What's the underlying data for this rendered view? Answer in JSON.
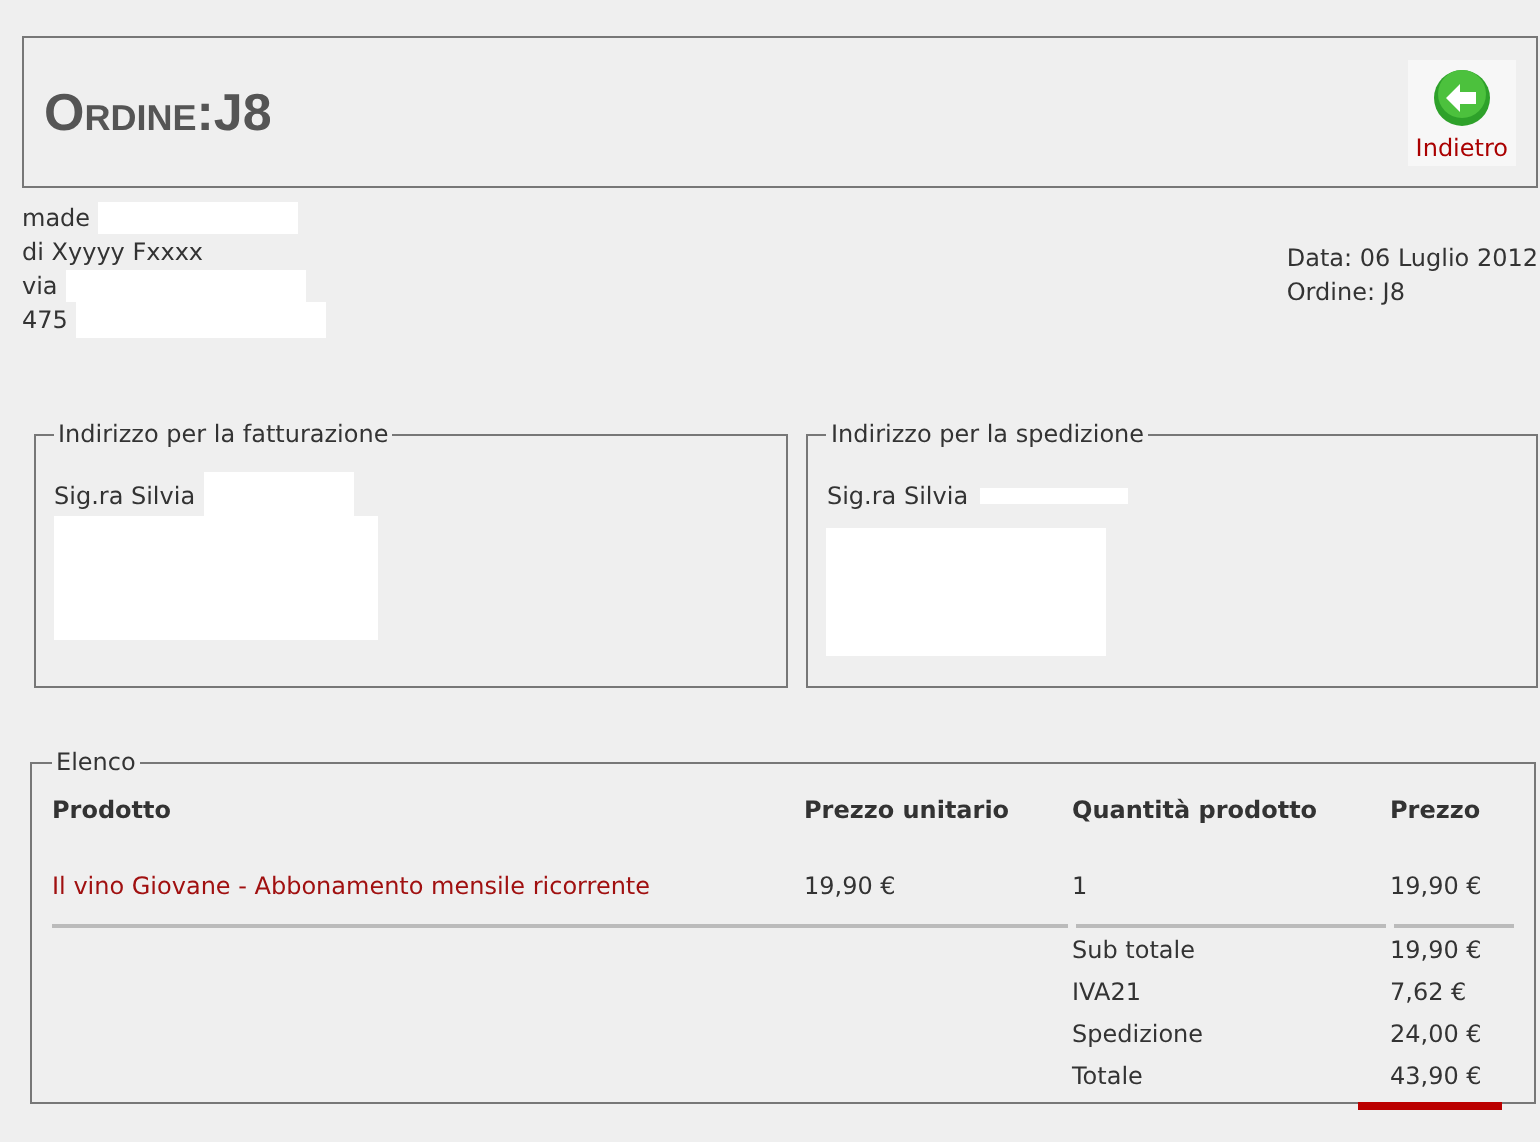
{
  "header": {
    "title": "Ordine:J8",
    "back_button": "Indietro"
  },
  "sender": {
    "lines": [
      "made",
      "di Xyyyy Fxxxx",
      "via",
      "475"
    ]
  },
  "order_info": {
    "date": "Data: 06 Luglio 2012",
    "order": "Ordine: J8"
  },
  "addresses": [
    {
      "legend": "Indirizzo per la fatturazione",
      "name": "Sig.ra Silvia"
    },
    {
      "legend": "Indirizzo per la spedizione",
      "name": "Sig.ra Silvia"
    }
  ],
  "items": {
    "legend": "Elenco",
    "columns": [
      "Prodotto",
      "Prezzo unitario",
      "Quantità prodotto",
      "Prezzo"
    ],
    "rows": [
      {
        "product": "Il vino Giovane - Abbonamento mensile ricorrente",
        "unit_price": "19,90 €",
        "quantity": "1",
        "price": "19,90 €"
      }
    ],
    "totals": [
      {
        "label": "Sub totale",
        "value": "19,90 €"
      },
      {
        "label": "IVA21",
        "value": "7,62 €"
      },
      {
        "label": "Spedizione",
        "value": "24,00 €"
      },
      {
        "label": "Totale",
        "value": "43,90 €",
        "kind": "grand"
      }
    ]
  }
}
